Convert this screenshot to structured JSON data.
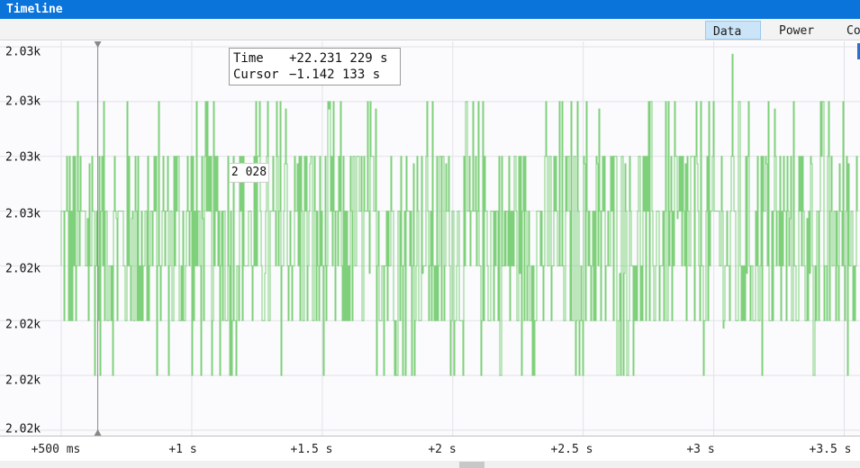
{
  "window": {
    "title": "Timeline"
  },
  "tabs": [
    {
      "label": "Data",
      "active": true
    },
    {
      "label": "Power",
      "active": false
    },
    {
      "label": "Co",
      "active": false
    }
  ],
  "tooltip": {
    "time_label": "Time",
    "time_value": "+22.231 229 s",
    "cursor_label": "Cursor",
    "cursor_value": "−1.142 133 s"
  },
  "value_label": "2 028",
  "colors": {
    "signal": "#7fd07a",
    "titlebar": "#0a74da",
    "grid": "#e1e1e8",
    "cursor": "#888888"
  },
  "chart_data": {
    "type": "line",
    "y_tick_labels": [
      "2.03k",
      "2.03k",
      "2.03k",
      "2.03k",
      "2.02k",
      "2.02k",
      "2.02k",
      "2.02k"
    ],
    "x_tick_labels": [
      "+500 ms",
      "+1 s",
      "+1.5 s",
      "+2 s",
      "+2.5 s",
      "+3 s",
      "+3.5 s"
    ],
    "x_range_s": [
      0.5,
      3.55
    ],
    "y_range": [
      2023,
      2030
    ],
    "cursor_x_s": 0.64,
    "baseline_levels": [
      2024,
      2025,
      2026,
      2027,
      2028,
      2029
    ],
    "series": [
      {
        "level_min": 2024,
        "level_max": 2029
      }
    ],
    "grid": true
  }
}
